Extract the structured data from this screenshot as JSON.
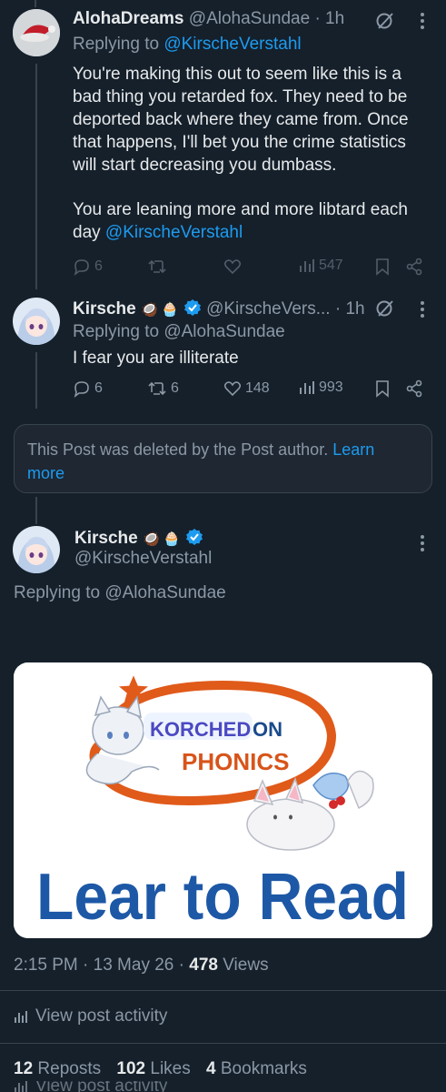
{
  "reply1": {
    "display_name": "AlohaDreams",
    "handle": "@AlohaSundae",
    "time": "· 1h",
    "replying_prefix": "Replying to ",
    "replying_to": "@KirscheVerstahl",
    "text_lines": [
      "You're making this out to seem like this is a",
      "bad thing you retarded fox. They need to be",
      "deported back where they came from. Once",
      "that happens, I'll bet you the crime statistics",
      "will start decreasing you dumbass."
    ],
    "text2_line1": "You are leaning more and more libtard each",
    "text2_prefix": "day ",
    "text2_mention": "@KirscheVerstahl",
    "replies": "6",
    "views": "547"
  },
  "reply2": {
    "display_name": "Kirsche",
    "emoji": "🥥 🧁",
    "handle": "@KirscheVers...",
    "time": "· 1h",
    "replying_to_full": "Replying to @AlohaSundae",
    "text": "I fear you are illiterate",
    "replies": "6",
    "reposts": "6",
    "likes": "148",
    "views": "993"
  },
  "deleted": {
    "text": "This Post was deleted by the Post author.",
    "learn_more_line1": "Learn",
    "learn_more_line2": "more"
  },
  "main_post": {
    "display_name": "Kirsche",
    "emoji": "🥥 🧁",
    "handle": "@KirscheVerstahl",
    "replying_to_full": "Replying to @AlohaSundae",
    "meme_text_korched": "KORCHED",
    "meme_text_on": "ON",
    "meme_text_phonics": "PHONICS",
    "meme_text_bottom": "Lear to Read",
    "timestamp": "2:15 PM · 13 May 26 · ",
    "views_count": "478",
    "views_label": " Views",
    "post_activity": "View post activity",
    "reposts_count": "12",
    "reposts_label": " Reposts",
    "likes_count": "102",
    "likes_label": " Likes",
    "bookmarks_count": "4",
    "bookmarks_label": " Bookmarks",
    "cutoff_text": "View post activity"
  },
  "colors": {
    "background": "#15202b",
    "accent": "#1d9bf0",
    "muted": "#8b98a5",
    "border": "#38444d"
  }
}
